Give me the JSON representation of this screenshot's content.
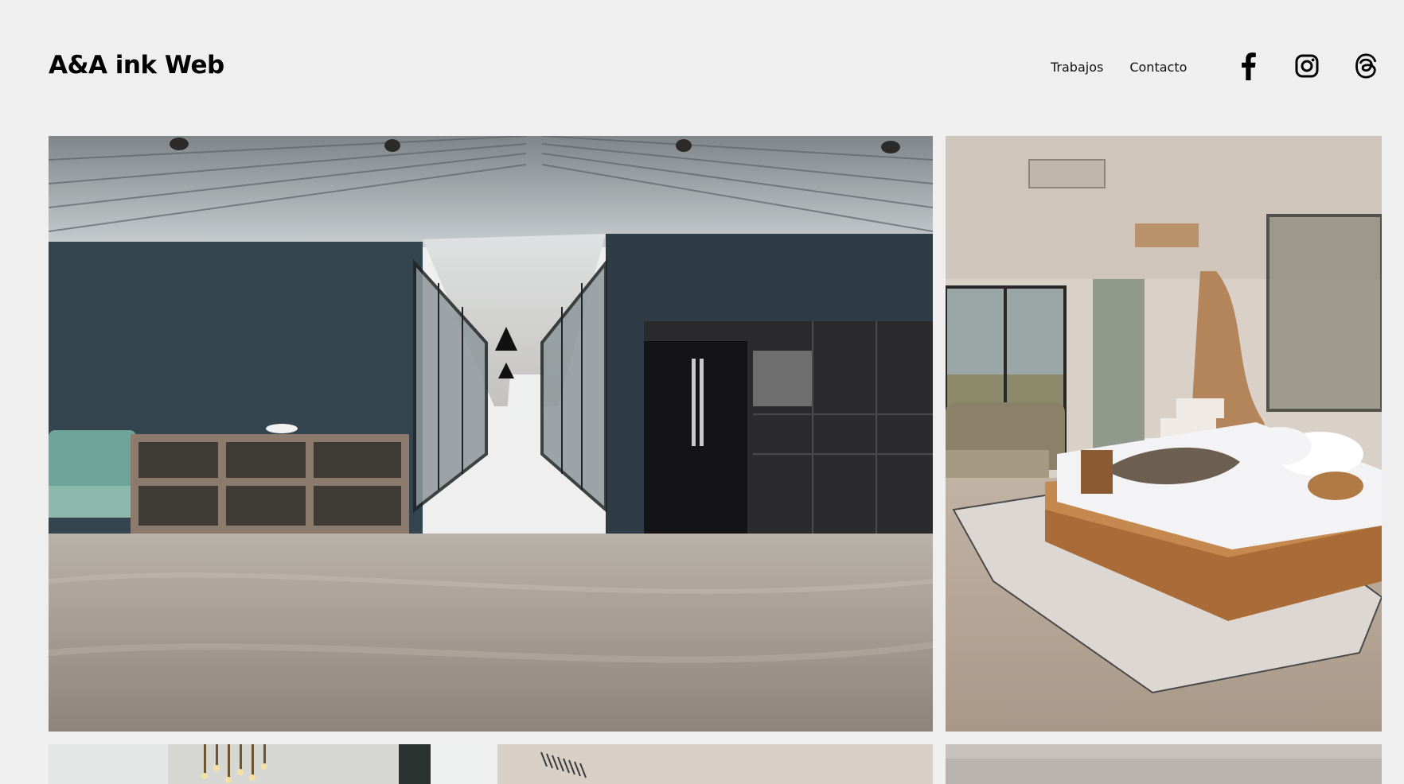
{
  "site": {
    "title": "A&A ink Web"
  },
  "nav": {
    "items": [
      {
        "label": "Trabajos"
      },
      {
        "label": "Contacto"
      }
    ]
  },
  "social": [
    {
      "icon": "facebook-icon"
    },
    {
      "icon": "instagram-icon"
    },
    {
      "icon": "threads-icon"
    }
  ],
  "gallery": {
    "tiles": [
      {
        "subject": "office-hallway-kitchen"
      },
      {
        "subject": "bedroom-platform-bed"
      },
      {
        "subject": "chandelier-stairwell"
      },
      {
        "subject": "interior-ceiling-vent"
      },
      {
        "subject": "interior-neutral-room"
      }
    ]
  }
}
